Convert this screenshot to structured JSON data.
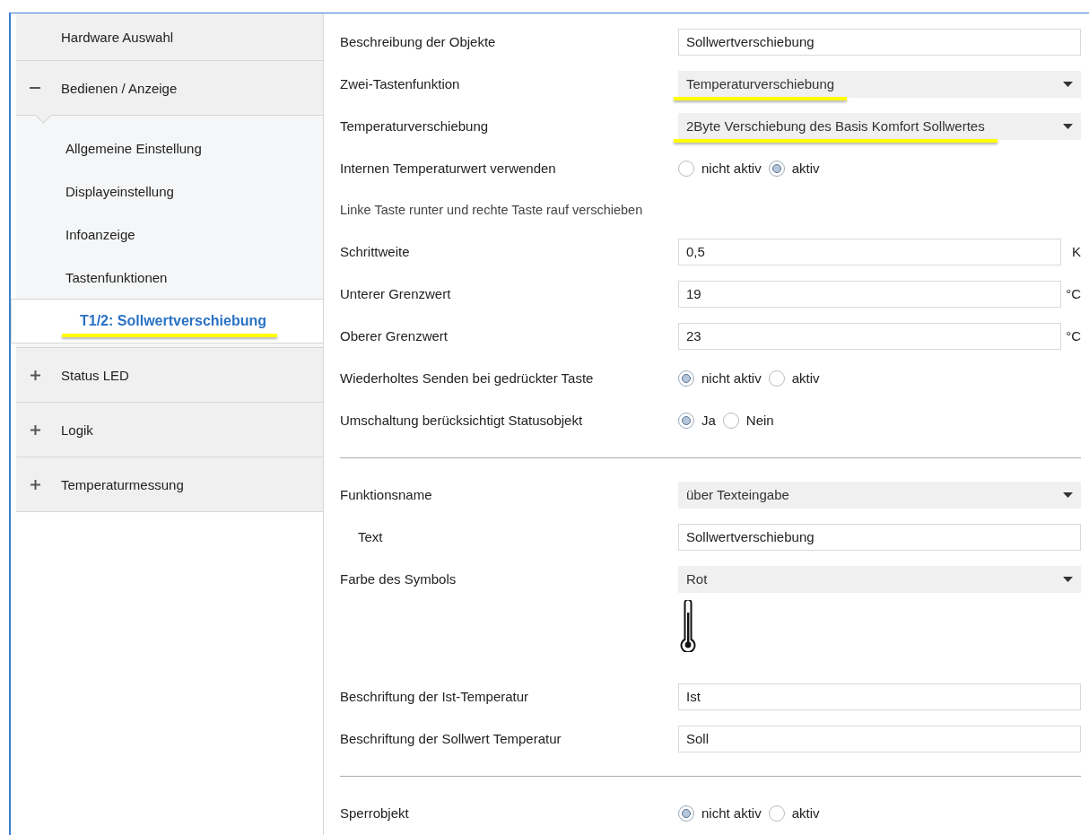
{
  "sidebar": {
    "items": [
      {
        "label": "Hardware Auswahl",
        "selected": false,
        "highlighted": false
      },
      {
        "label": "Bedienen / Anzeige",
        "selected": false,
        "highlighted": false,
        "expanded": true,
        "children": [
          {
            "label": "Allgemeine Einstellung",
            "selected": false,
            "highlighted": false
          },
          {
            "label": "Displayeinstellung",
            "selected": false,
            "highlighted": false
          },
          {
            "label": "Infoanzeige",
            "selected": false,
            "highlighted": false
          },
          {
            "label": "Tastenfunktionen",
            "selected": false,
            "highlighted": false,
            "children": [
              {
                "label": "T1/2: Sollwertverschiebung",
                "selected": true,
                "highlighted": true
              }
            ]
          }
        ]
      },
      {
        "label": "Status LED",
        "selected": false,
        "highlighted": false,
        "expanded": false
      },
      {
        "label": "Logik",
        "selected": false,
        "highlighted": false,
        "expanded": false
      },
      {
        "label": "Temperaturmessung",
        "selected": false,
        "highlighted": false,
        "expanded": false
      }
    ]
  },
  "rows": [
    {
      "kind": "text",
      "label": "Beschreibung der Objekte",
      "value": "Sollwertverschiebung"
    },
    {
      "kind": "select",
      "label": "Zwei-Tastenfunktion",
      "value": "Temperaturverschiebung",
      "highlighted": true
    },
    {
      "kind": "select",
      "label": "Temperaturverschiebung",
      "value": "2Byte Verschiebung des Basis Komfort Sollwertes",
      "highlighted": true
    },
    {
      "kind": "radio",
      "label": "Internen Temperaturwert verwenden",
      "options": [
        {
          "label": "nicht aktiv",
          "selected": false
        },
        {
          "label": "aktiv",
          "selected": true
        }
      ]
    },
    {
      "kind": "note",
      "label": "Linke Taste runter und rechte Taste rauf verschieben"
    },
    {
      "kind": "text",
      "label": "Schrittweite",
      "value": "0,5",
      "unit": "K"
    },
    {
      "kind": "text",
      "label": "Unterer Grenzwert",
      "value": "19",
      "unit": "°C"
    },
    {
      "kind": "text",
      "label": "Oberer Grenzwert",
      "value": "23",
      "unit": "°C"
    },
    {
      "kind": "radio",
      "label": "Wiederholtes Senden bei gedrückter Taste",
      "options": [
        {
          "label": "nicht aktiv",
          "selected": true
        },
        {
          "label": "aktiv",
          "selected": false
        }
      ]
    },
    {
      "kind": "radio",
      "label": "Umschaltung berücksichtigt Statusobjekt",
      "options": [
        {
          "label": "Ja",
          "selected": true
        },
        {
          "label": "Nein",
          "selected": false
        }
      ]
    },
    {
      "kind": "divider"
    },
    {
      "kind": "select",
      "label": "Funktionsname",
      "value": "über Texteingabe",
      "highlighted": false
    },
    {
      "kind": "text",
      "label": "Text",
      "value": "Sollwertverschiebung",
      "indented": true
    },
    {
      "kind": "select",
      "label": "Farbe des Symbols",
      "value": "Rot",
      "highlighted": false
    },
    {
      "kind": "icon"
    },
    {
      "kind": "text",
      "label": "Beschriftung der Ist-Temperatur",
      "value": "Ist"
    },
    {
      "kind": "text",
      "label": "Beschriftung der Sollwert Temperatur",
      "value": "Soll"
    },
    {
      "kind": "divider"
    },
    {
      "kind": "radio",
      "label": "Sperrobjekt",
      "options": [
        {
          "label": "nicht aktiv",
          "selected": true
        },
        {
          "label": "aktiv",
          "selected": false
        }
      ]
    }
  ]
}
